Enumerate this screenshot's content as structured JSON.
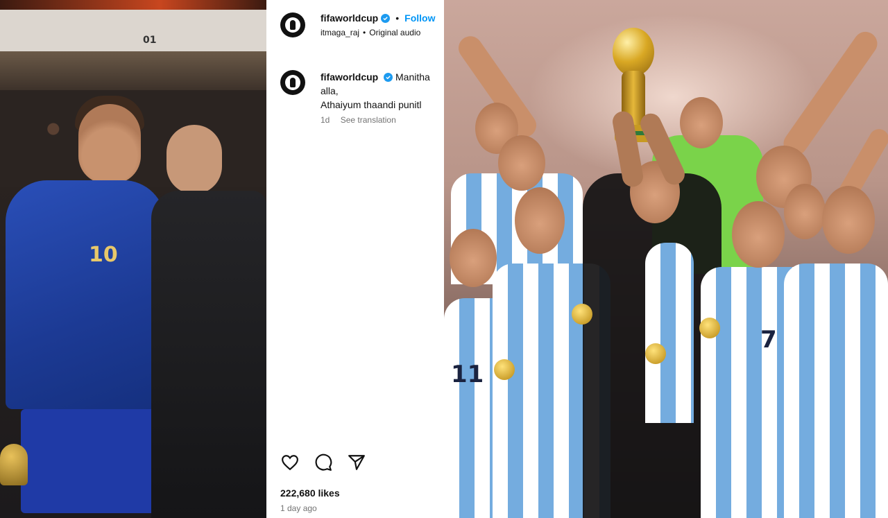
{
  "left_photo": {
    "gate_number": "01",
    "jersey_number": "10"
  },
  "post": {
    "username": "fifaworldcup",
    "follow_label": "Follow",
    "audio_user": "itmaga_raj",
    "audio_label": "Original audio",
    "caption_username": "fifaworldcup",
    "caption_lines": [
      "Manitha",
      "alla,",
      "Athaiyum thaandi punitl"
    ],
    "caption_age": "1d",
    "see_translation": "See translation",
    "likes": "222,680 likes",
    "posted_ago": "1 day ago"
  },
  "icons": {
    "like": "heart-icon",
    "comment": "comment-icon",
    "share": "paper-plane-icon",
    "verified": "verified-badge-icon"
  },
  "colors": {
    "follow": "#0095f6",
    "verified": "#1d9bf0",
    "meta_text": "#737373",
    "argentina_blue": "#74acdf"
  },
  "right_photo": {
    "player_numbers": [
      "11",
      "7"
    ]
  }
}
